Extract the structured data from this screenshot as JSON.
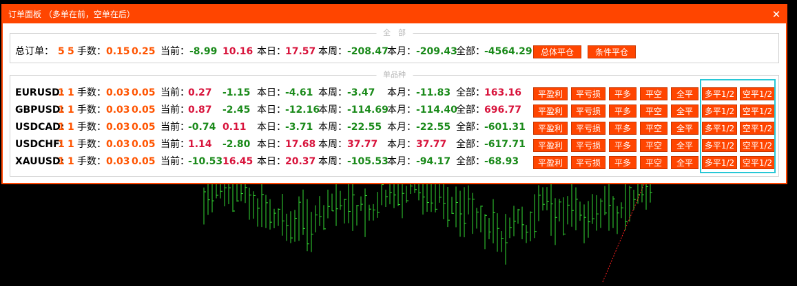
{
  "title": "订单面板 （多单在前，空单在后）",
  "close_glyph": "✕",
  "summary": {
    "group_label": "全　部",
    "orders_label": "总订单：",
    "orders_buy": "5",
    "orders_sell": "5",
    "lots_label": "手数：",
    "lots_buy": "0.15",
    "lots_sell": "0.25",
    "current_label": "当前：",
    "current_buy": "-8.99",
    "current_sell": "10.16",
    "day_label": "本日：",
    "day_value": "17.57",
    "week_label": "本周：",
    "week_value": "-208.47",
    "month_label": "本月：",
    "month_value": "-209.43",
    "all_label": "全部：",
    "all_value": "-4564.29",
    "btn_close_all": "总体平仓",
    "btn_conditional": "条件平仓"
  },
  "single": {
    "group_label": "单品种",
    "lots_label": "手数：",
    "current_label": "当前：",
    "day_label": "本日：",
    "week_label": "本周：",
    "month_label": "本月：",
    "all_label": "全部：",
    "buttons": [
      "平盈利",
      "平亏损",
      "平多",
      "平空",
      "全平",
      "多平1/2",
      "空平1/2"
    ],
    "rows": [
      {
        "symbol": "EURUSD:",
        "buy_orders": "1",
        "sell_orders": "1",
        "lots_buy": "0.03",
        "lots_sell": "0.05",
        "cur_buy": "0.27",
        "cur_sell": "-1.15",
        "day": "-4.61",
        "week": "-3.47",
        "month": "-11.83",
        "all": "163.16"
      },
      {
        "symbol": "GBPUSD:",
        "buy_orders": "1",
        "sell_orders": "1",
        "lots_buy": "0.03",
        "lots_sell": "0.05",
        "cur_buy": "0.87",
        "cur_sell": "-2.45",
        "day": "-12.16",
        "week": "-114.69",
        "month": "-114.40",
        "all": "696.77"
      },
      {
        "symbol": "USDCAD:",
        "buy_orders": "1",
        "sell_orders": "1",
        "lots_buy": "0.03",
        "lots_sell": "0.05",
        "cur_buy": "-0.74",
        "cur_sell": "0.11",
        "day": "-3.71",
        "week": "-22.55",
        "month": "-22.55",
        "all": "-601.31"
      },
      {
        "symbol": "USDCHF:",
        "buy_orders": "1",
        "sell_orders": "1",
        "lots_buy": "0.03",
        "lots_sell": "0.05",
        "cur_buy": "1.14",
        "cur_sell": "-2.80",
        "day": "17.68",
        "week": "37.77",
        "month": "37.77",
        "all": "-617.71"
      },
      {
        "symbol": "XAUUSD:",
        "buy_orders": "1",
        "sell_orders": "1",
        "lots_buy": "0.03",
        "lots_sell": "0.05",
        "cur_buy": "-10.53",
        "cur_sell": "16.45",
        "day": "20.37",
        "week": "-105.53",
        "month": "-94.17",
        "all": "-68.93"
      }
    ]
  },
  "colors": {
    "accent": "#ff4500",
    "positive": "#d8143c",
    "negative": "#1a8a1a",
    "count": "#ff5400",
    "highlight": "#27c7d6",
    "chart_bars": "#33dd33",
    "trend_line": "#ff2020"
  }
}
